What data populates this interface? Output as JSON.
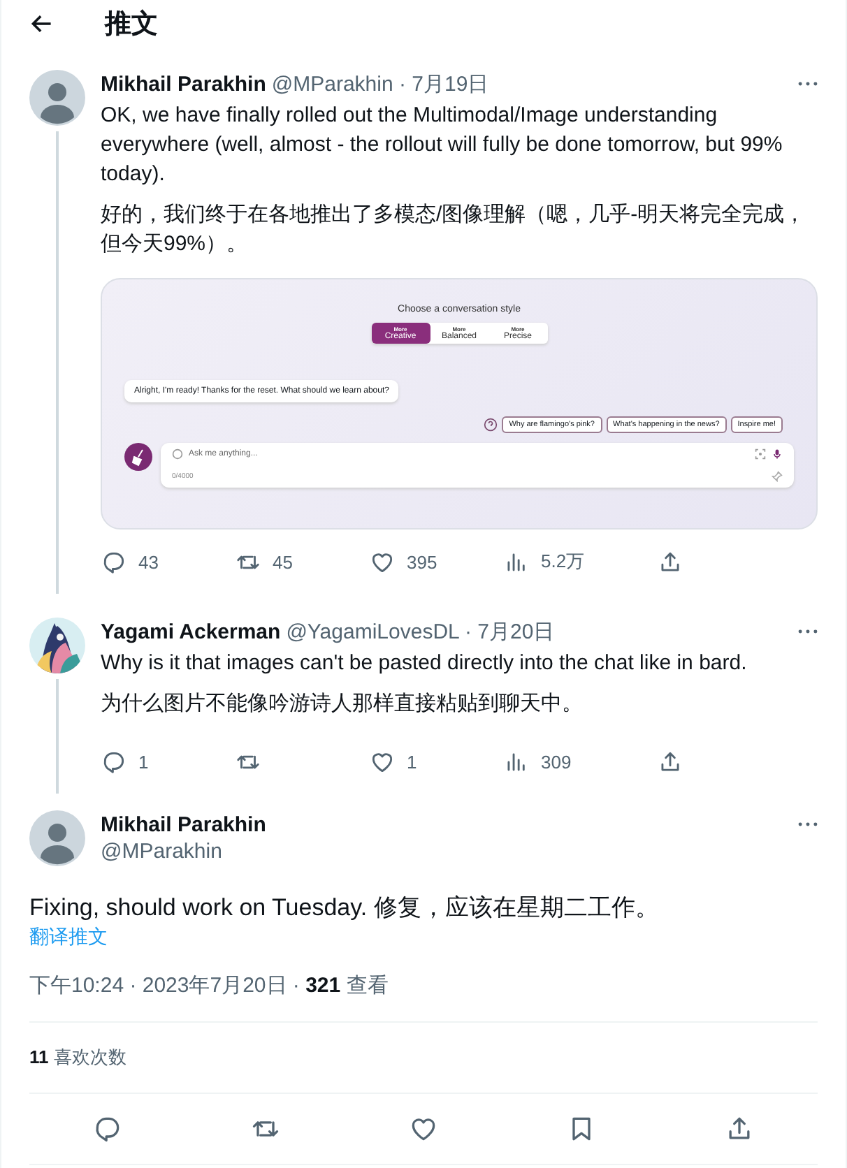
{
  "header": {
    "title": "推文"
  },
  "thread": [
    {
      "avatar": {
        "kind": "silhouette"
      },
      "name": "Mikhail Parakhin",
      "handle": "@MParakhin",
      "date": "· 7月19日",
      "paragraphs": [
        "OK, we have finally rolled out the Multimodal/Image understanding everywhere (well, almost - the rollout will fully be done tomorrow, but 99% today).",
        "好的，我们终于在各地推出了多模态/图像理解（嗯，几乎-明天将完全完成，但今天99%）。"
      ],
      "embed": {
        "title": "Choose a conversation style",
        "styles": [
          {
            "top": "More",
            "label": "Creative",
            "selected": true
          },
          {
            "top": "More",
            "label": "Balanced",
            "selected": false
          },
          {
            "top": "More",
            "label": "Precise",
            "selected": false
          }
        ],
        "message": "Alright, I'm ready! Thanks for the reset. What should we learn about?",
        "suggestions": [
          "Why are flamingo's pink?",
          "What's happening in the news?",
          "Inspire me!"
        ],
        "placeholder": "Ask me anything...",
        "counter": "0/4000"
      },
      "stats": [
        {
          "kind": "reply",
          "count": "43"
        },
        {
          "kind": "retweet",
          "count": "45"
        },
        {
          "kind": "like",
          "count": "395"
        },
        {
          "kind": "views",
          "count": "5.2万"
        },
        {
          "kind": "share"
        }
      ]
    },
    {
      "avatar": {
        "kind": "picture"
      },
      "name": "Yagami Ackerman",
      "handle": "@YagamiLovesDL",
      "date": "· 7月20日",
      "paragraphs": [
        "Why is it that images can't be pasted directly into the chat like in bard.",
        "为什么图片不能像吟游诗人那样直接粘贴到聊天中。"
      ],
      "stats": [
        {
          "kind": "reply",
          "count": "1"
        },
        {
          "kind": "retweet"
        },
        {
          "kind": "like",
          "count": "1"
        },
        {
          "kind": "views",
          "count": "309"
        },
        {
          "kind": "share"
        }
      ]
    }
  ],
  "main": {
    "name": "Mikhail Parakhin",
    "handle": "@MParakhin",
    "text": "Fixing, should work on Tuesday. 修复，应该在星期二工作。",
    "translate": "翻译推文",
    "time": "下午10:24 · 2023年7月20日 · ",
    "views": "321",
    "views_label": "查看",
    "likes": "11",
    "likes_label": "喜欢次数"
  },
  "actions": [
    {
      "kind": "reply"
    },
    {
      "kind": "retweet"
    },
    {
      "kind": "like"
    },
    {
      "kind": "bookmark"
    },
    {
      "kind": "share"
    }
  ]
}
